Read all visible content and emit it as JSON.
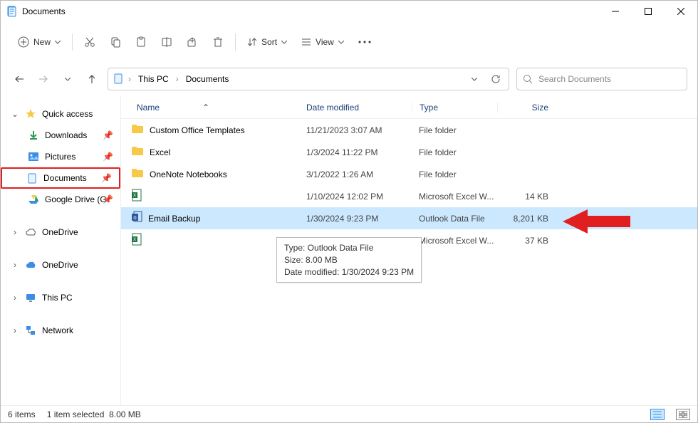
{
  "titlebar": {
    "title": "Documents"
  },
  "toolbar": {
    "new_label": "New",
    "sort_label": "Sort",
    "view_label": "View"
  },
  "address": {
    "crumb1": "This PC",
    "crumb2": "Documents"
  },
  "search": {
    "placeholder": "Search Documents"
  },
  "sidebar": {
    "quick_access": "Quick access",
    "downloads": "Downloads",
    "pictures": "Pictures",
    "documents": "Documents",
    "google_drive": "Google Drive (G",
    "onedrive1": "OneDrive",
    "onedrive2": "OneDrive",
    "this_pc": "This PC",
    "network": "Network"
  },
  "columns": {
    "name": "Name",
    "date": "Date modified",
    "type": "Type",
    "size": "Size"
  },
  "rows": [
    {
      "name": "Custom Office Templates",
      "date": "11/21/2023 3:07 AM",
      "type": "File folder",
      "size": "",
      "kind": "folder"
    },
    {
      "name": "Excel",
      "date": "1/3/2024 11:22 PM",
      "type": "File folder",
      "size": "",
      "kind": "folder"
    },
    {
      "name": "OneNote Notebooks",
      "date": "3/1/2022 1:26 AM",
      "type": "File folder",
      "size": "",
      "kind": "folder"
    },
    {
      "name": "",
      "date": "1/10/2024 12:02 PM",
      "type": "Microsoft Excel W...",
      "size": "14 KB",
      "kind": "excel"
    },
    {
      "name": "Email Backup",
      "date": "1/30/2024 9:23 PM",
      "type": "Outlook Data File",
      "size": "8,201 KB",
      "kind": "outlook",
      "selected": true
    },
    {
      "name": "",
      "date": "",
      "type": "Microsoft Excel W...",
      "size": "37 KB",
      "kind": "excel"
    }
  ],
  "tooltip": {
    "line1": "Type: Outlook Data File",
    "line2": "Size: 8.00 MB",
    "line3": "Date modified: 1/30/2024 9:23 PM"
  },
  "status": {
    "items": "6 items",
    "selected": "1 item selected",
    "size": "8.00 MB"
  }
}
